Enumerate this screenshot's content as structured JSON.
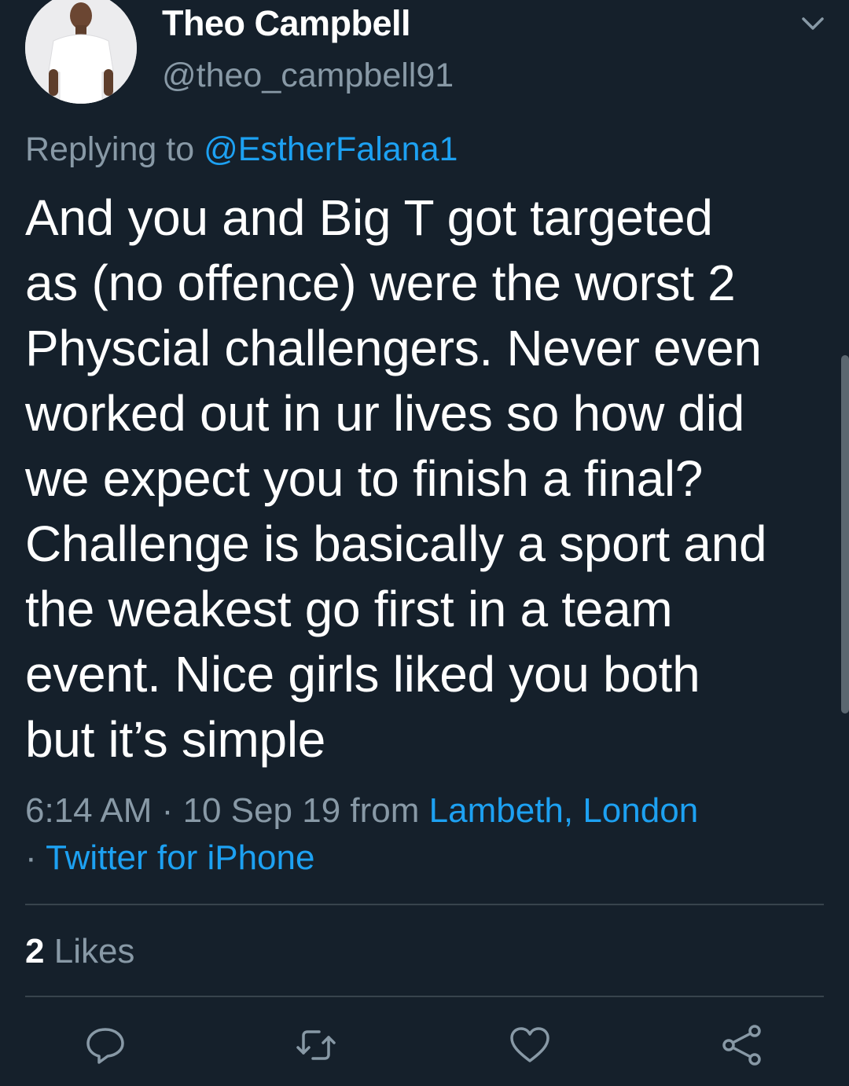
{
  "author": {
    "display_name": "Theo Campbell",
    "handle": "@theo_campbell91"
  },
  "reply": {
    "prefix": "Replying to",
    "mention": "@EstherFalana1"
  },
  "tweet": {
    "lines": [
      "And you and Big T got targeted",
      "as (no offence) were the worst 2",
      "Physcial challengers. Never even",
      "worked out in ur lives so how did",
      "we expect you to finish a final?",
      "Challenge is basically a sport and",
      "the weakest go first in a team",
      "event. Nice girls liked you both",
      "but it’s simple"
    ]
  },
  "meta": {
    "time": "6:14 AM",
    "separator": "·",
    "date": "10 Sep 19",
    "from_word": "from",
    "location": "Lambeth, London",
    "source": "Twitter for iPhone"
  },
  "stats": {
    "likes_count": "2",
    "likes_label": "Likes"
  },
  "icons": {
    "caret": "chevron-down-icon",
    "reply": "reply-icon",
    "retweet": "retweet-icon",
    "like": "heart-icon",
    "share": "share-icon"
  },
  "colors": {
    "background": "#15202b",
    "accent": "#1da1f2",
    "secondary_text": "#8899a6",
    "divider": "#38444d"
  }
}
